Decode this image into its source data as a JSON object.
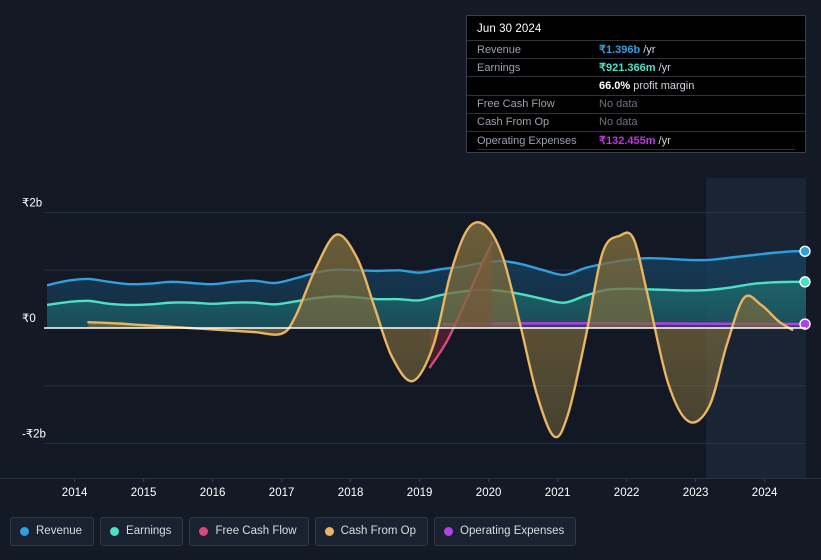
{
  "tooltip": {
    "title": "Jun 30 2024",
    "rows": [
      {
        "label": "Revenue",
        "value": "₹1.396b",
        "unit": "/yr",
        "color": "#2f9fe0",
        "nodata": false
      },
      {
        "label": "Earnings",
        "value": "₹921.366m",
        "unit": "/yr",
        "color": "#4ce0c4",
        "nodata": false
      },
      {
        "label": "",
        "value": "66.0%",
        "unit": "profit margin",
        "color": "#ffffff",
        "nodata": false
      },
      {
        "label": "Free Cash Flow",
        "value": "No data",
        "unit": "",
        "color": "#6b7280",
        "nodata": true
      },
      {
        "label": "Cash From Op",
        "value": "No data",
        "unit": "",
        "color": "#6b7280",
        "nodata": true
      },
      {
        "label": "Operating Expenses",
        "value": "₹132.455m",
        "unit": "/yr",
        "color": "#bf35e0",
        "nodata": false
      }
    ]
  },
  "legend": {
    "items": [
      {
        "label": "Revenue",
        "color": "#2f9fe0",
        "icon": "legend-dot-icon"
      },
      {
        "label": "Earnings",
        "color": "#4ce0c4",
        "icon": "legend-dot-icon"
      },
      {
        "label": "Free Cash Flow",
        "color": "#d94a7a",
        "icon": "legend-dot-icon"
      },
      {
        "label": "Cash From Op",
        "color": "#e8b563",
        "icon": "legend-dot-icon"
      },
      {
        "label": "Operating Expenses",
        "color": "#b341e8",
        "icon": "legend-dot-icon"
      }
    ]
  },
  "chart_data": {
    "type": "area",
    "title": "",
    "xlabel": "",
    "ylabel": "",
    "ylim": [
      -2.6,
      2.6
    ],
    "y_unit": "b",
    "currency": "₹",
    "grid": true,
    "legend_position": "bottom",
    "y_ticks": [
      {
        "value": 2,
        "label": "₹2b"
      },
      {
        "value": 0,
        "label": "₹0"
      },
      {
        "value": -2,
        "label": "-₹2b"
      }
    ],
    "x_ticks": [
      "2014",
      "2015",
      "2016",
      "2017",
      "2018",
      "2019",
      "2020",
      "2021",
      "2022",
      "2023",
      "2024"
    ],
    "x_range": [
      2013.6,
      2024.6
    ],
    "highlight_band": {
      "from": 2023.15,
      "to": 2024.6,
      "label": "recent-period"
    },
    "series": [
      {
        "name": "Revenue",
        "color": "#2f9fe0",
        "fill": "#16405d",
        "end_marker": true,
        "x": [
          2013.6,
          2013.9,
          2014.2,
          2014.5,
          2014.8,
          2015.1,
          2015.4,
          2015.7,
          2016.0,
          2016.3,
          2016.6,
          2016.9,
          2017.2,
          2017.5,
          2017.8,
          2018.1,
          2018.4,
          2018.7,
          2019.0,
          2019.3,
          2019.6,
          2019.9,
          2020.2,
          2020.5,
          2020.8,
          2021.1,
          2021.4,
          2021.7,
          2022.0,
          2022.3,
          2022.6,
          2022.9,
          2023.2,
          2023.5,
          2023.8,
          2024.1,
          2024.4,
          2024.6
        ],
        "values": [
          0.74,
          0.82,
          0.85,
          0.8,
          0.76,
          0.77,
          0.8,
          0.78,
          0.76,
          0.8,
          0.82,
          0.78,
          0.86,
          0.96,
          1.01,
          1.0,
          0.99,
          1.0,
          0.96,
          1.02,
          1.06,
          1.13,
          1.16,
          1.1,
          1.0,
          0.92,
          1.04,
          1.12,
          1.18,
          1.21,
          1.2,
          1.18,
          1.18,
          1.22,
          1.26,
          1.3,
          1.33,
          1.33
        ]
      },
      {
        "name": "Earnings",
        "color": "#4ce0c4",
        "fill": "#1e6a6c",
        "end_marker": true,
        "x": [
          2013.6,
          2013.9,
          2014.2,
          2014.5,
          2014.8,
          2015.1,
          2015.4,
          2015.7,
          2016.0,
          2016.3,
          2016.6,
          2016.9,
          2017.2,
          2017.5,
          2017.8,
          2018.1,
          2018.4,
          2018.7,
          2019.0,
          2019.3,
          2019.6,
          2019.9,
          2020.2,
          2020.5,
          2020.8,
          2021.1,
          2021.4,
          2021.7,
          2022.0,
          2022.3,
          2022.6,
          2022.9,
          2023.2,
          2023.5,
          2023.8,
          2024.1,
          2024.4,
          2024.6
        ],
        "values": [
          0.4,
          0.45,
          0.47,
          0.42,
          0.4,
          0.41,
          0.44,
          0.44,
          0.42,
          0.44,
          0.44,
          0.41,
          0.46,
          0.52,
          0.55,
          0.53,
          0.5,
          0.5,
          0.48,
          0.57,
          0.63,
          0.66,
          0.64,
          0.58,
          0.5,
          0.44,
          0.56,
          0.66,
          0.68,
          0.67,
          0.66,
          0.65,
          0.66,
          0.7,
          0.76,
          0.79,
          0.8,
          0.8
        ]
      },
      {
        "name": "Free Cash Flow",
        "color": "#d94a7a",
        "fill": "#6d2434",
        "end_marker": false,
        "x": [
          2019.15,
          2019.4,
          2019.65,
          2019.9,
          2020.05
        ],
        "values": [
          -0.68,
          -0.22,
          0.42,
          1.1,
          1.48
        ]
      },
      {
        "name": "Cash From Op",
        "color": "#e8b563",
        "fill": "#7a6a3c",
        "end_marker": false,
        "x": [
          2014.2,
          2014.6,
          2015.0,
          2015.4,
          2015.8,
          2016.2,
          2016.6,
          2017.0,
          2017.2,
          2017.5,
          2017.8,
          2018.1,
          2018.35,
          2018.6,
          2018.9,
          2019.2,
          2019.45,
          2019.7,
          2019.95,
          2020.2,
          2020.45,
          2020.7,
          2020.95,
          2021.15,
          2021.4,
          2021.65,
          2021.9,
          2022.1,
          2022.3,
          2022.6,
          2022.9,
          2023.2,
          2023.45,
          2023.7,
          2023.95,
          2024.2,
          2024.4
        ],
        "values": [
          0.1,
          0.08,
          0.05,
          0.02,
          -0.01,
          -0.04,
          -0.07,
          -0.1,
          0.2,
          1.05,
          1.62,
          1.2,
          0.35,
          -0.5,
          -0.92,
          -0.3,
          0.95,
          1.72,
          1.78,
          1.25,
          0.1,
          -1.15,
          -1.88,
          -1.5,
          -0.2,
          1.3,
          1.6,
          1.55,
          0.6,
          -0.95,
          -1.62,
          -1.35,
          -0.3,
          0.52,
          0.4,
          0.12,
          -0.03
        ]
      },
      {
        "name": "Operating Expenses",
        "color": "#b341e8",
        "fill": "#5a2a78",
        "end_marker": true,
        "x": [
          2019.35,
          2020.0,
          2020.6,
          2021.2,
          2021.8,
          2022.4,
          2023.0,
          2023.6,
          2024.1,
          2024.6
        ],
        "values": [
          0.065,
          0.075,
          0.08,
          0.082,
          0.08,
          0.078,
          0.075,
          0.072,
          0.07,
          0.068
        ]
      }
    ]
  }
}
